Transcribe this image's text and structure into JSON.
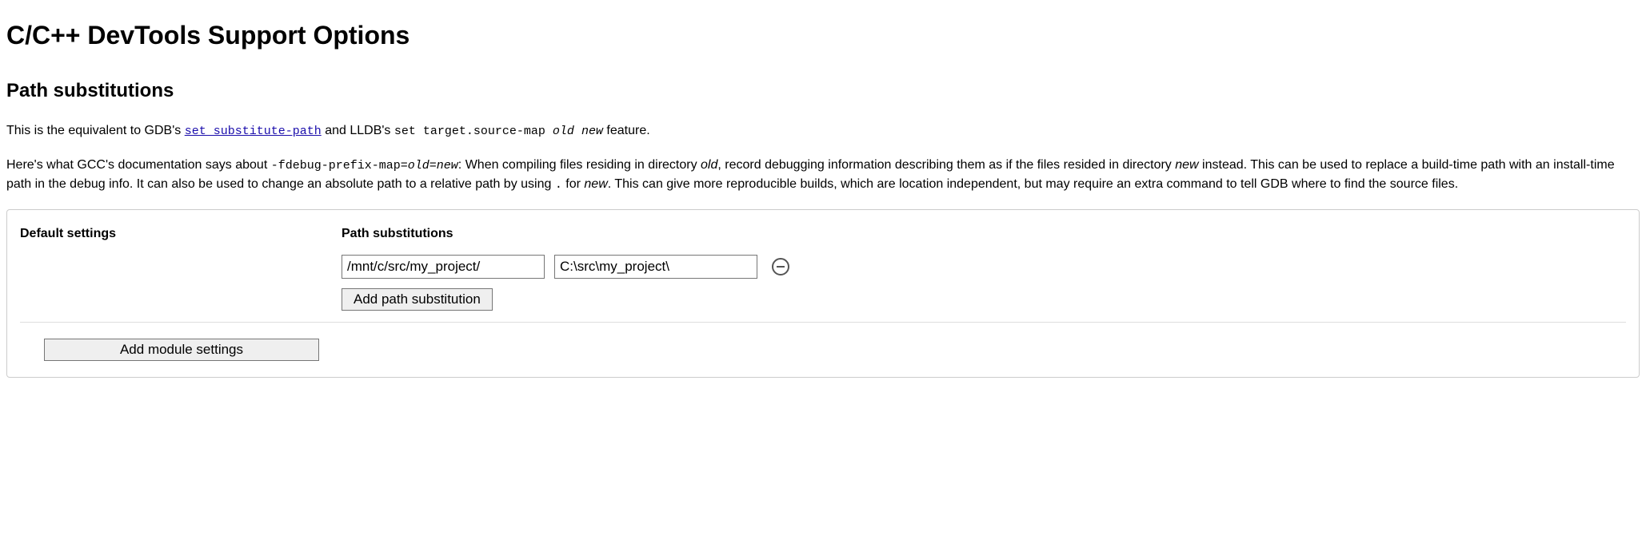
{
  "header": {
    "title": "C/C++ DevTools Support Options",
    "subtitle": "Path substitutions"
  },
  "intro": {
    "p1_prefix": "This is the equivalent to GDB's ",
    "p1_link": "set substitute-path",
    "p1_mid": " and LLDB's ",
    "p1_cmd": "set target.source-map ",
    "p1_cmd_arg1": "old",
    "p1_cmd_sep": " ",
    "p1_cmd_arg2": "new",
    "p1_suffix": " feature.",
    "p2_prefix": "Here's what GCC's documentation says about ",
    "p2_flag": "-fdebug-prefix-map=",
    "p2_flag_arg1": "old",
    "p2_flag_eq": "=",
    "p2_flag_arg2": "new",
    "p2_colon": ": When compiling files residing in directory ",
    "p2_old": "old",
    "p2_mid1": ", record debugging information describing them as if the files resided in directory ",
    "p2_new": "new",
    "p2_mid2": " instead. This can be used to replace a build-time path with an install-time path in the debug info. It can also be used to change an absolute path to a relative path by using ",
    "p2_dot": ".",
    "p2_mid3": " for ",
    "p2_new2": "new",
    "p2_suffix": ". This can give more reproducible builds, which are location independent, but may require an extra command to tell GDB where to find the source files."
  },
  "panel": {
    "default_label": "Default settings",
    "path_subs_label": "Path substitutions",
    "row": {
      "from": "/mnt/c/src/my_project/",
      "to": "C:\\src\\my_project\\"
    },
    "add_path_label": "Add path substitution",
    "add_module_label": "Add module settings"
  }
}
